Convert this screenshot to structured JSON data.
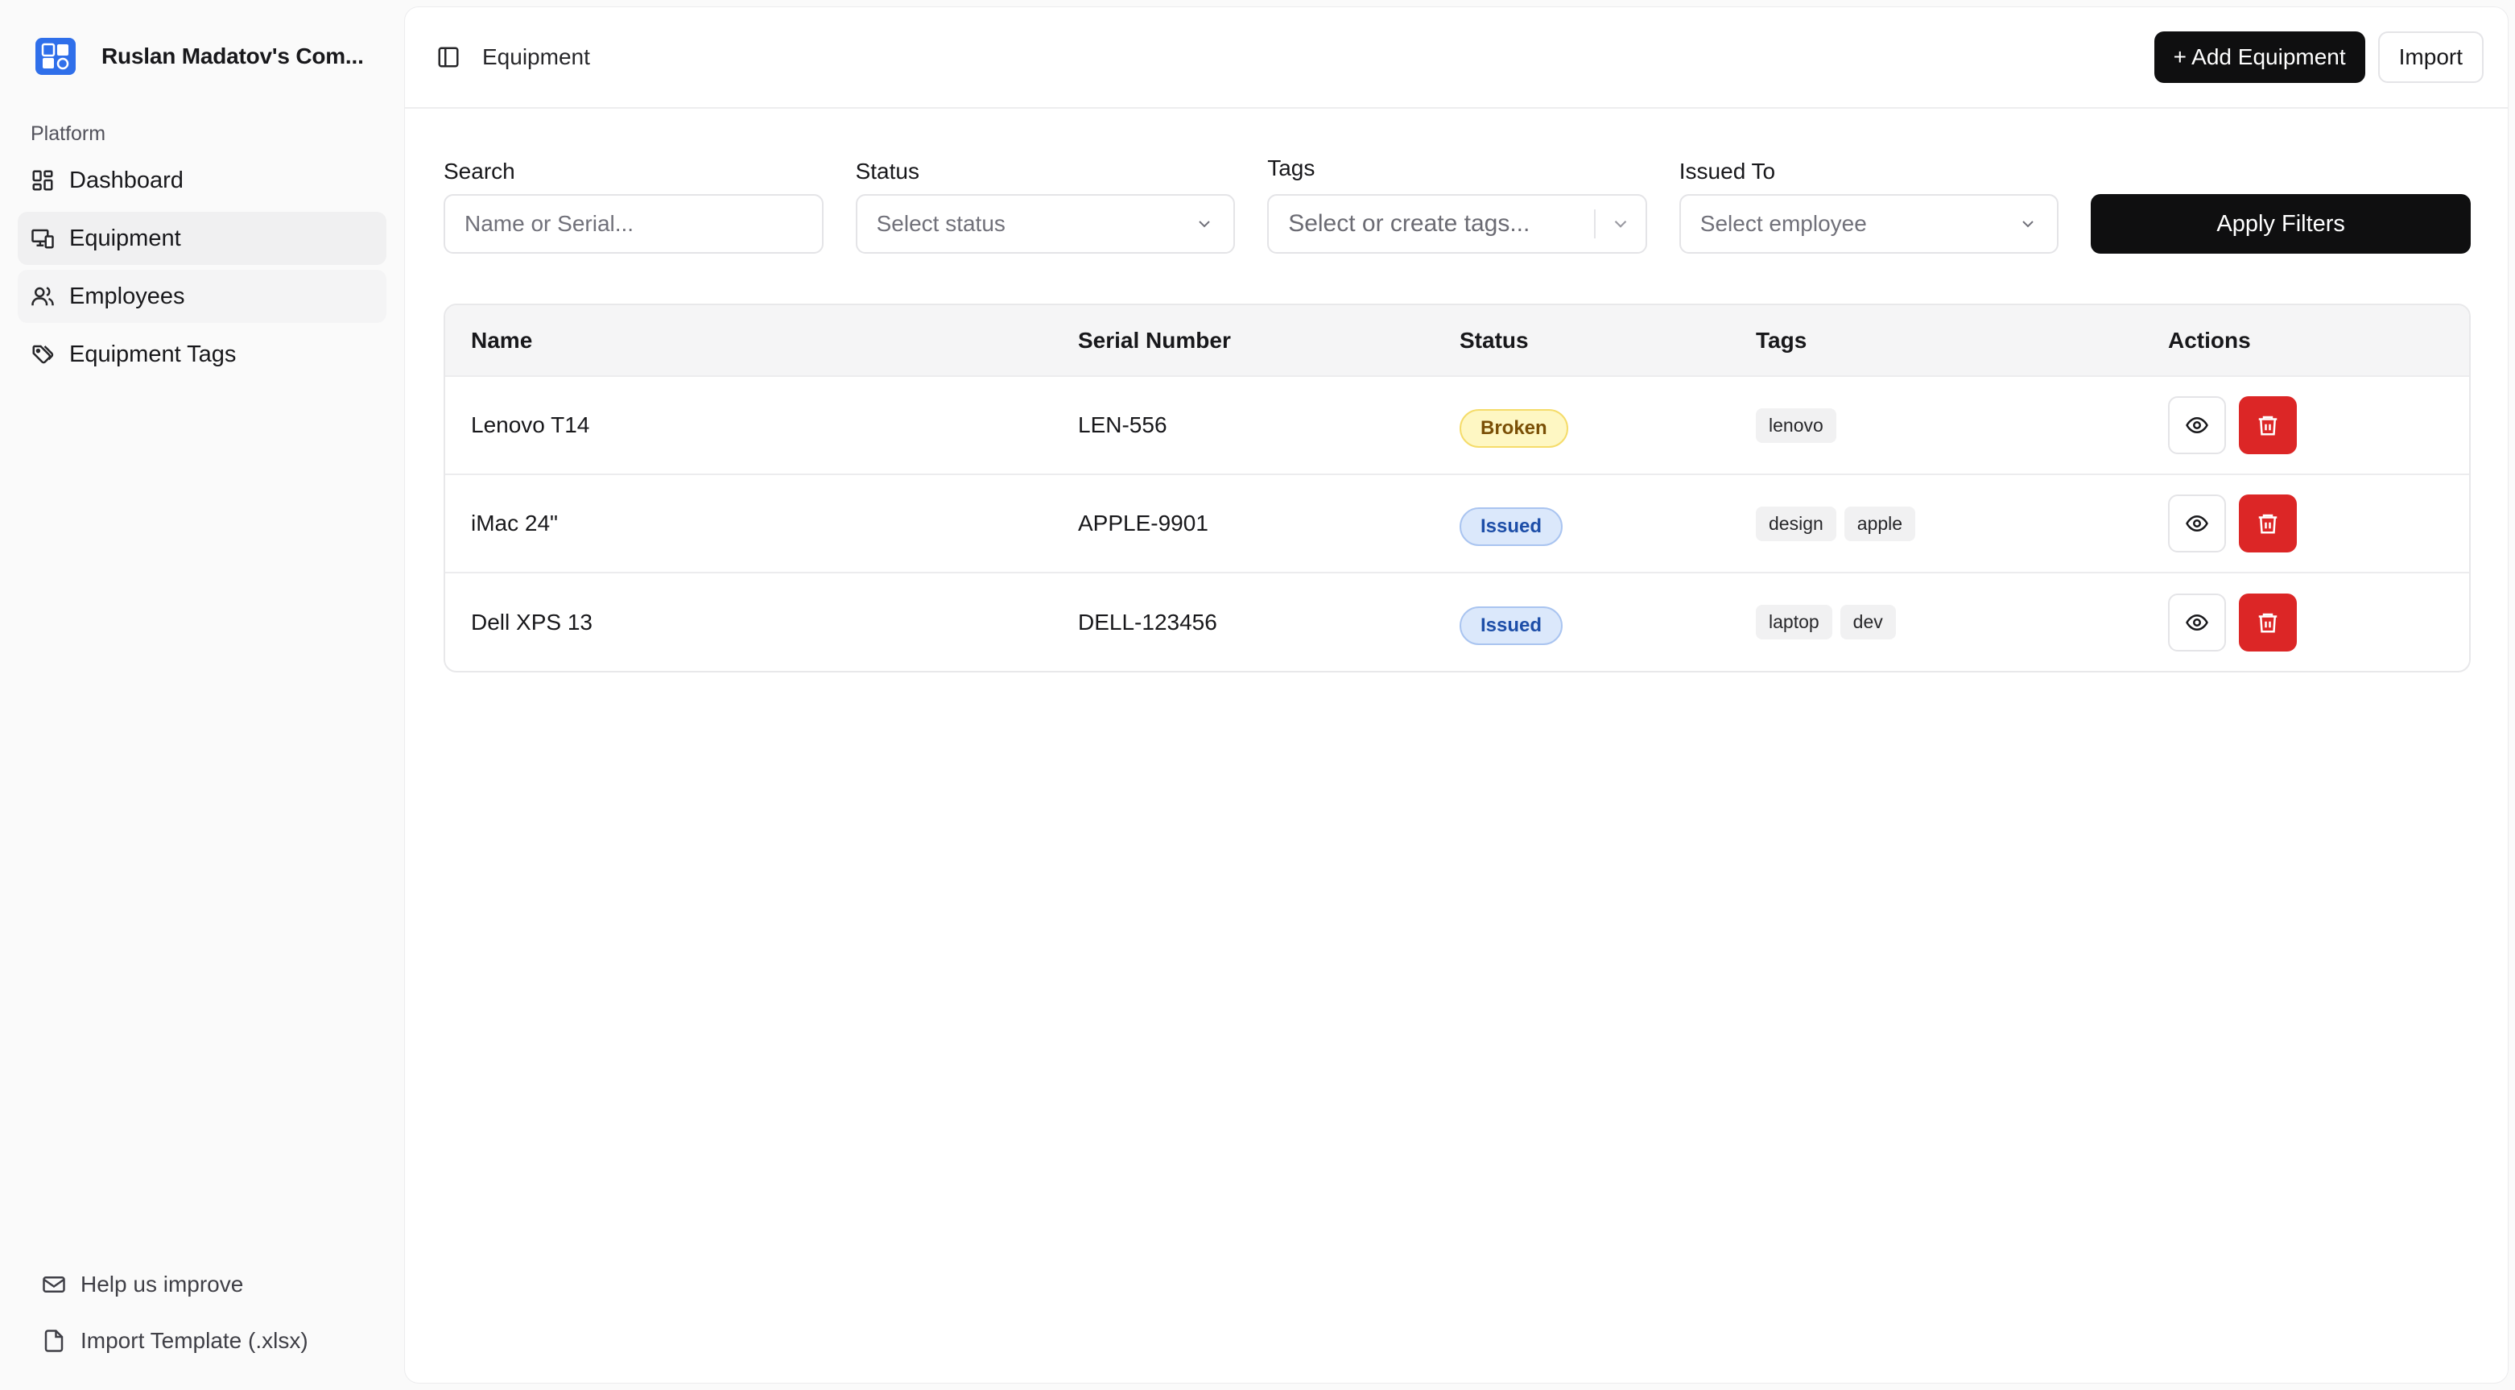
{
  "brand": {
    "name": "Ruslan Madatov's Com..."
  },
  "sidebar": {
    "section_label": "Platform",
    "items": [
      {
        "label": "Dashboard",
        "icon": "dashboard-icon"
      },
      {
        "label": "Equipment",
        "icon": "equipment-icon"
      },
      {
        "label": "Employees",
        "icon": "users-icon"
      },
      {
        "label": "Equipment Tags",
        "icon": "tags-icon"
      }
    ],
    "footer": [
      {
        "label": "Help us improve",
        "icon": "mail-icon"
      },
      {
        "label": "Import Template (.xlsx)",
        "icon": "file-icon"
      }
    ]
  },
  "header": {
    "title": "Equipment",
    "add_label": "+ Add Equipment",
    "import_label": "Import"
  },
  "filters": {
    "search_label": "Search",
    "search_placeholder": "Name or Serial...",
    "status_label": "Status",
    "status_placeholder": "Select status",
    "tags_label": "Tags",
    "tags_placeholder": "Select or create tags...",
    "issued_label": "Issued To",
    "issued_placeholder": "Select employee",
    "apply_label": "Apply Filters"
  },
  "table": {
    "columns": [
      "Name",
      "Serial Number",
      "Status",
      "Tags",
      "Actions"
    ],
    "rows": [
      {
        "name": "Lenovo T14",
        "serial": "LEN-556",
        "status": "Broken",
        "tags": [
          "lenovo"
        ]
      },
      {
        "name": "iMac 24\"",
        "serial": "APPLE-9901",
        "status": "Issued",
        "tags": [
          "design",
          "apple"
        ]
      },
      {
        "name": "Dell XPS 13",
        "serial": "DELL-123456",
        "status": "Issued",
        "tags": [
          "laptop",
          "dev"
        ]
      }
    ]
  },
  "colors": {
    "primary_dark": "#0f0f10",
    "danger": "#dc2626",
    "brand_blue": "#2f6fea",
    "status_broken_bg": "#fef7c3",
    "status_issued_bg": "#dbe8fb"
  }
}
